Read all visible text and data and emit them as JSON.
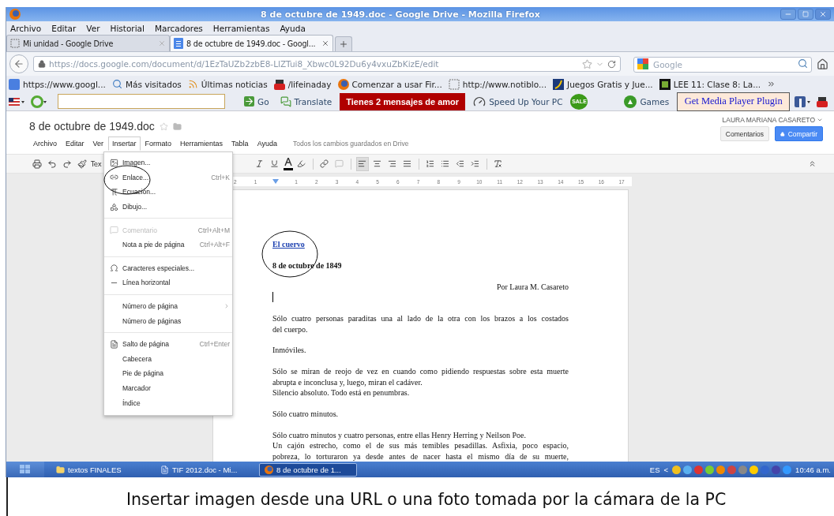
{
  "window": {
    "title": "8 de octubre de 1949.doc - Google Drive - Mozilla Firefox"
  },
  "menu_bar": [
    "Archivo",
    "Editar",
    "Ver",
    "Historial",
    "Marcadores",
    "Herramientas",
    "Ayuda"
  ],
  "tabs": [
    {
      "label": "Mi unidad - Google Drive",
      "selected": false,
      "kind": "blank"
    },
    {
      "label": "8 de octubre de 1949.doc - Googl...",
      "selected": true,
      "kind": "doc"
    }
  ],
  "address_bar": {
    "value": "https://docs.google.com/document/d/1EzTaUZb2zbE8-LlZTui8_Xbwc0L92Du6y4vxuZbKizE/edit"
  },
  "search": {
    "placeholder": "Google"
  },
  "bookmarks": [
    {
      "label": "https://www.googl...",
      "kind": "square"
    },
    {
      "label": "Más visitados",
      "kind": "magnifier"
    },
    {
      "label": "Últimas noticias",
      "kind": "feed"
    },
    {
      "label": "/lifeinaday",
      "kind": "video"
    },
    {
      "label": "Comenzar a usar Fir...",
      "kind": "fox"
    },
    {
      "label": "http://www.notiblo...",
      "kind": "blank"
    },
    {
      "label": "Juegos Gratis y Jue...",
      "kind": "swoosh"
    },
    {
      "label": "LEE 11: Clase 8: La...",
      "kind": "tile"
    }
  ],
  "addon_bar": {
    "go": "Go",
    "translate": "Translate",
    "promo": "Tienes 2 mensajes de amor",
    "speed": "Speed Up Your PC",
    "sale": "SALE",
    "games": "Games",
    "plugin": "Get Media Player Plugin"
  },
  "docs": {
    "title": "8 de octubre de 1949.doc",
    "user": "LAURA MARIANA CASARETO",
    "comments_button": "Comentarios",
    "share_button": "Compartir",
    "save_status": "Todos los cambios guardados en Drive",
    "menu": [
      {
        "label": "Archivo",
        "selected": false
      },
      {
        "label": "Editar",
        "selected": false
      },
      {
        "label": "Ver",
        "selected": false
      },
      {
        "label": "Insertar",
        "selected": true
      },
      {
        "label": "Formato",
        "selected": false
      },
      {
        "label": "Herramientas",
        "selected": false
      },
      {
        "label": "Tabla",
        "selected": false
      },
      {
        "label": "Ayuda",
        "selected": false
      }
    ],
    "style_fragment": "Tex",
    "align_buttons": [
      {
        "selected": true
      },
      {
        "selected": false
      },
      {
        "selected": false
      },
      {
        "selected": false
      }
    ],
    "ruler_labels": [
      "2",
      "1",
      "1",
      "2",
      "3",
      "4",
      "5",
      "6",
      "7",
      "8",
      "9",
      "10",
      "11",
      "12",
      "13",
      "14",
      "15",
      "16",
      "17"
    ],
    "insert_menu": [
      {
        "kind": "image",
        "label": "Imagen...",
        "disabled": false
      },
      {
        "kind": "link",
        "label": "Enlace...",
        "shortcut": "Ctrl+K",
        "disabled": false
      },
      {
        "kind": "equation",
        "label": "Ecuación...",
        "disabled": false
      },
      {
        "kind": "drawing",
        "label": "Dibujo...",
        "disabled": false
      },
      {
        "kind": "divider"
      },
      {
        "kind": "comment",
        "label": "Comentario",
        "shortcut": "Ctrl+Alt+M",
        "disabled": true
      },
      {
        "kind": "plain",
        "label": "Nota a pie de página",
        "shortcut": "Ctrl+Alt+F",
        "disabled": false
      },
      {
        "kind": "divider"
      },
      {
        "kind": "omega",
        "label": "Caracteres especiales...",
        "disabled": false
      },
      {
        "kind": "rule",
        "label": "Línea horizontal",
        "disabled": false
      },
      {
        "kind": "divider"
      },
      {
        "kind": "submenu",
        "label": "Número de página",
        "disabled": false
      },
      {
        "kind": "plain",
        "label": "Número de páginas",
        "disabled": false
      },
      {
        "kind": "divider"
      },
      {
        "kind": "pagebreak",
        "label": "Salto de página",
        "shortcut": "Ctrl+Enter",
        "disabled": false
      },
      {
        "kind": "plain",
        "label": "Cabecera",
        "disabled": false
      },
      {
        "kind": "plain",
        "label": "Pie de página",
        "disabled": false
      },
      {
        "kind": "plain",
        "label": "Marcador",
        "disabled": false
      },
      {
        "kind": "plain",
        "label": "Índice",
        "disabled": false
      }
    ],
    "document": [
      {
        "kind": "link-title",
        "lines": [
          "El cuervo"
        ]
      },
      {
        "kind": "heading",
        "lines": [
          "8 de octubre de 1849"
        ]
      },
      {
        "kind": "byline",
        "lines": [
          "Por Laura M. Casareto"
        ]
      },
      {
        "kind": "cursor"
      },
      {
        "kind": "body",
        "lines": [
          "Sólo cuatro personas paraditas una al lado de la otra con los brazos a los costados",
          "del cuerpo."
        ]
      },
      {
        "kind": "body",
        "lines": [
          "Inmóviles."
        ]
      },
      {
        "kind": "body",
        "lines": [
          "Sólo se miran de reojo de vez en cuando como pidiendo respuestas sobre esta muerte",
          "abrupta e inconclusa y, luego, miran el cadáver."
        ]
      },
      {
        "kind": "continuation",
        "lines": [
          "Silencio absoluto. Todo está en penumbras."
        ]
      },
      {
        "kind": "body",
        "lines": [
          "Sólo cuatro minutos."
        ]
      },
      {
        "kind": "body",
        "lines": [
          "Sólo cuatro minutos y cuatro personas, entre ellas Henry Herring y Neilson Poe."
        ]
      },
      {
        "kind": "open-continuation",
        "lines": [
          "Un cajón estrecho, como el de sus más temibles pesadillas. Asfixia, poco espacio,",
          "pobreza, lo torturaron ya desde antes de nacer hasta el mismo día de su muerte,"
        ]
      }
    ]
  },
  "taskbar": {
    "items": [
      {
        "label": "textos FINALES",
        "selected": false,
        "kind": "folder"
      },
      {
        "label": "TIF 2012.doc - Mi...",
        "selected": false,
        "kind": "word"
      },
      {
        "label": "8 de octubre de 1...",
        "selected": true,
        "kind": "fox"
      }
    ],
    "language": "ES",
    "expand": "<",
    "clock": "10:46 a.m."
  },
  "caption": "Insertar imagen desde una URL o una foto tomada por la cámara de la PC"
}
